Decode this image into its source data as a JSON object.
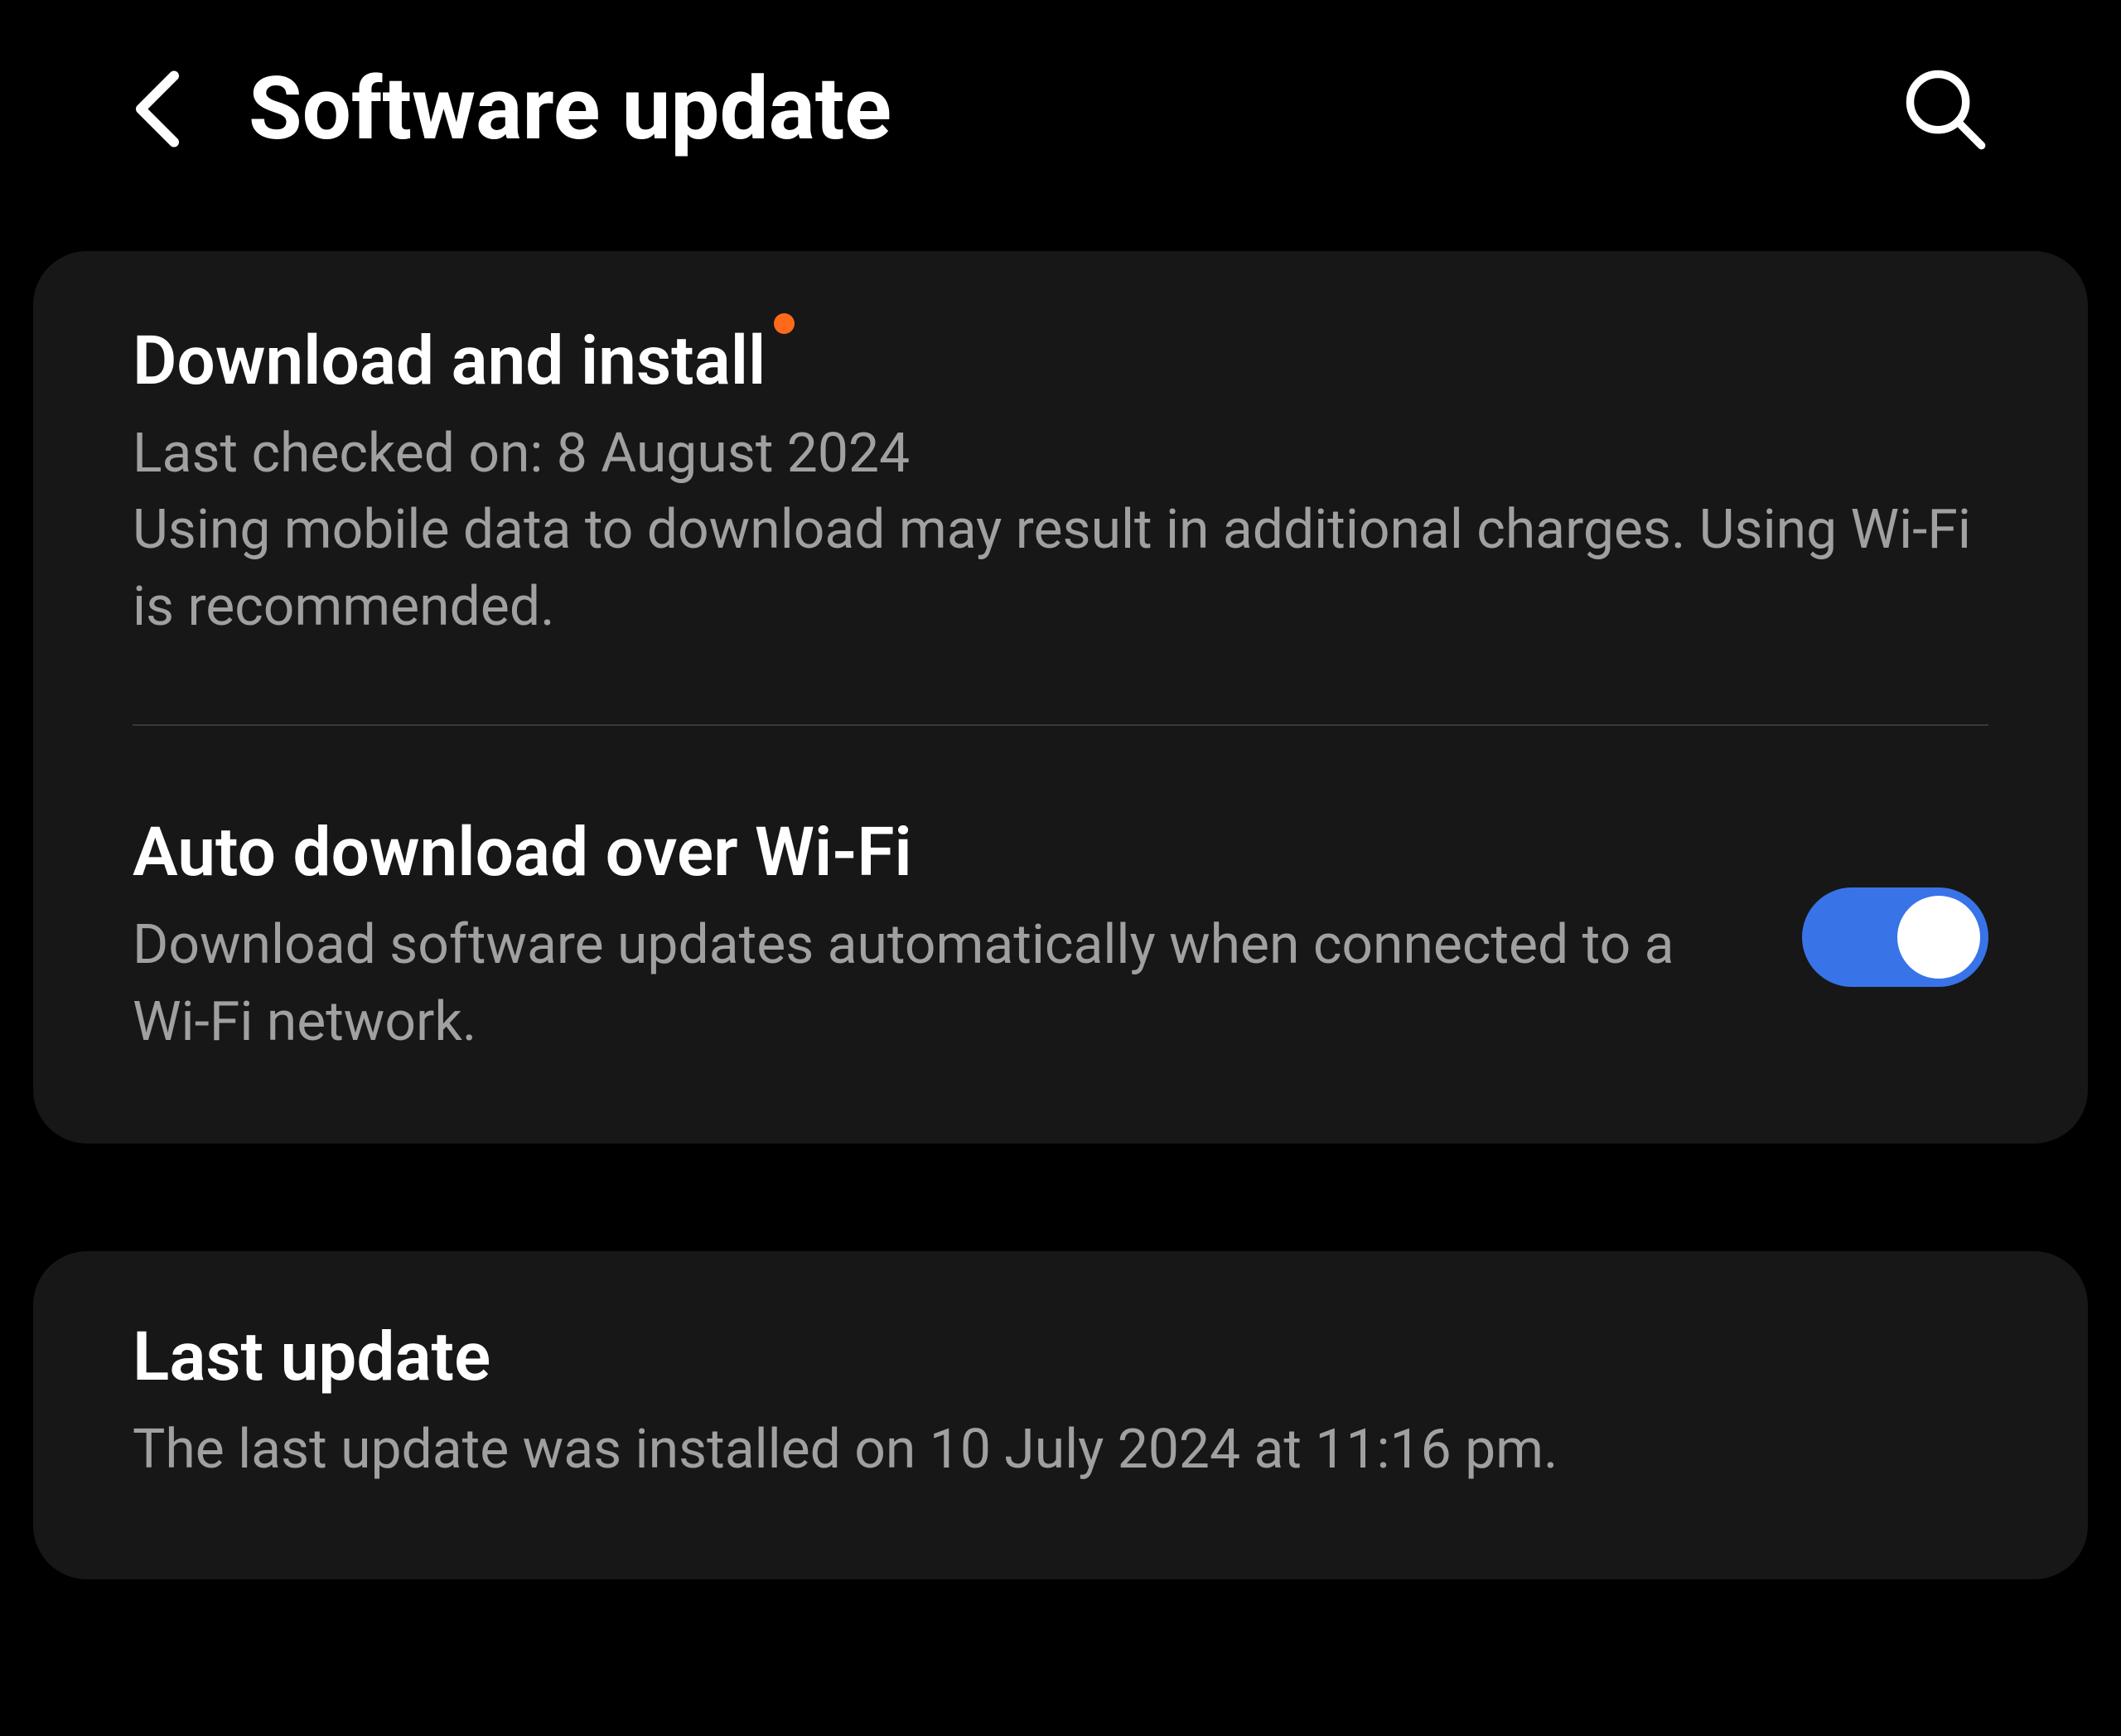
{
  "header": {
    "title": "Software update"
  },
  "download_install": {
    "title": "Download and install",
    "has_notification": true,
    "last_checked": "Last checked on: 8 August 2024",
    "warning": "Using mobile data to download may result in additional charges. Using Wi-Fi is recommended."
  },
  "auto_download": {
    "title": "Auto download over Wi-Fi",
    "description": "Download software updates automatically when connected to a Wi-Fi network.",
    "enabled": true
  },
  "last_update": {
    "title": "Last update",
    "description": "The last update was installed on 10 July 2024 at 11:16 pm."
  },
  "colors": {
    "accent": "#3873e8",
    "notification": "#ff6a1a",
    "background": "#000000",
    "card": "#171717",
    "text_primary": "#ffffff",
    "text_secondary": "#a0a0a0"
  }
}
